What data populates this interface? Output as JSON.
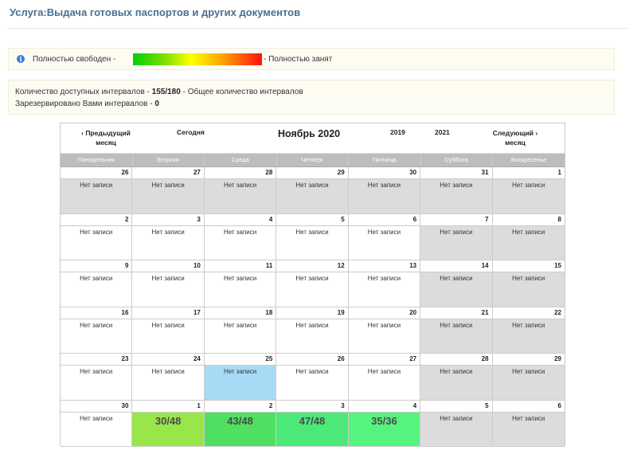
{
  "service_title": "Услуга:Выдача готовых паспортов и других документов",
  "legend": {
    "free_label": "Полностью свободен -",
    "busy_label": "- Полностью занят"
  },
  "stats": {
    "available_prefix": "Количество доступных интервалов -",
    "available_value": "155/180",
    "available_suffix": "- Общее количество интервалов",
    "reserved_label": "Зарезервировано Вами интервалов -",
    "reserved_value": "0"
  },
  "calendar": {
    "prev_label": "‹ Предыдущий месяц",
    "today_label": "Сегодня",
    "month_title": "Ноябрь 2020",
    "year_prev": "2019",
    "year_next": "2021",
    "next_label": "Следующий › месяц",
    "weekdays": [
      "Понедельник",
      "Вторник",
      "Среда",
      "Четверг",
      "Пятница",
      "Суббота",
      "Воскресенье"
    ],
    "cells": [
      {
        "day": "26",
        "text": "Нет записи",
        "state": "gray"
      },
      {
        "day": "27",
        "text": "Нет записи",
        "state": "gray"
      },
      {
        "day": "28",
        "text": "Нет записи",
        "state": "gray"
      },
      {
        "day": "29",
        "text": "Нет записи",
        "state": "gray"
      },
      {
        "day": "30",
        "text": "Нет записи",
        "state": "gray"
      },
      {
        "day": "31",
        "text": "Нет записи",
        "state": "gray"
      },
      {
        "day": "1",
        "text": "Нет записи",
        "state": "gray"
      },
      {
        "day": "2",
        "text": "Нет записи",
        "state": "white"
      },
      {
        "day": "3",
        "text": "Нет записи",
        "state": "white"
      },
      {
        "day": "4",
        "text": "Нет записи",
        "state": "white"
      },
      {
        "day": "5",
        "text": "Нет записи",
        "state": "white"
      },
      {
        "day": "6",
        "text": "Нет записи",
        "state": "white"
      },
      {
        "day": "7",
        "text": "Нет записи",
        "state": "gray"
      },
      {
        "day": "8",
        "text": "Нет записи",
        "state": "gray"
      },
      {
        "day": "9",
        "text": "Нет записи",
        "state": "white"
      },
      {
        "day": "10",
        "text": "Нет записи",
        "state": "white"
      },
      {
        "day": "11",
        "text": "Нет записи",
        "state": "white"
      },
      {
        "day": "12",
        "text": "Нет записи",
        "state": "white"
      },
      {
        "day": "13",
        "text": "Нет записи",
        "state": "white"
      },
      {
        "day": "14",
        "text": "Нет записи",
        "state": "gray"
      },
      {
        "day": "15",
        "text": "Нет записи",
        "state": "gray"
      },
      {
        "day": "16",
        "text": "Нет записи",
        "state": "white"
      },
      {
        "day": "17",
        "text": "Нет записи",
        "state": "white"
      },
      {
        "day": "18",
        "text": "Нет записи",
        "state": "white"
      },
      {
        "day": "19",
        "text": "Нет записи",
        "state": "white"
      },
      {
        "day": "20",
        "text": "Нет записи",
        "state": "white"
      },
      {
        "day": "21",
        "text": "Нет записи",
        "state": "gray"
      },
      {
        "day": "22",
        "text": "Нет записи",
        "state": "gray"
      },
      {
        "day": "23",
        "text": "Нет записи",
        "state": "white"
      },
      {
        "day": "24",
        "text": "Нет записи",
        "state": "white"
      },
      {
        "day": "25",
        "text": "Нет записи",
        "state": "blue"
      },
      {
        "day": "26",
        "text": "Нет записи",
        "state": "white"
      },
      {
        "day": "27",
        "text": "Нет записи",
        "state": "white"
      },
      {
        "day": "28",
        "text": "Нет записи",
        "state": "gray"
      },
      {
        "day": "29",
        "text": "Нет записи",
        "state": "gray"
      },
      {
        "day": "30",
        "text": "Нет записи",
        "state": "white"
      },
      {
        "day": "1",
        "text": "30/48",
        "state": "g30",
        "big": true
      },
      {
        "day": "2",
        "text": "43/48",
        "state": "g43",
        "big": true
      },
      {
        "day": "3",
        "text": "47/48",
        "state": "g47",
        "big": true
      },
      {
        "day": "4",
        "text": "35/36",
        "state": "g35",
        "big": true
      },
      {
        "day": "5",
        "text": "Нет записи",
        "state": "gray"
      },
      {
        "day": "6",
        "text": "Нет записи",
        "state": "gray"
      }
    ]
  }
}
